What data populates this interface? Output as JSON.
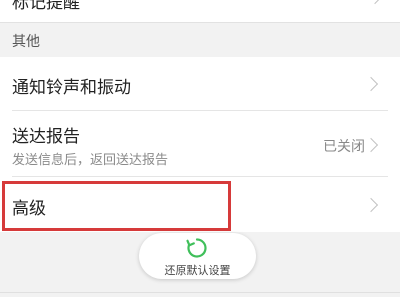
{
  "top_row": {
    "label": "标记提醒"
  },
  "section": {
    "header": "其他"
  },
  "rows": [
    {
      "title": "通知铃声和振动"
    },
    {
      "title": "送达报告",
      "subtitle": "发送信息后，返回送达报告",
      "value": "已关闭"
    },
    {
      "title": "高级"
    }
  ],
  "restore_button": {
    "label": "还原默认设置",
    "icon": "refresh-icon",
    "icon_color": "#3fbf5a"
  },
  "colors": {
    "highlight": "#d63a3a"
  }
}
